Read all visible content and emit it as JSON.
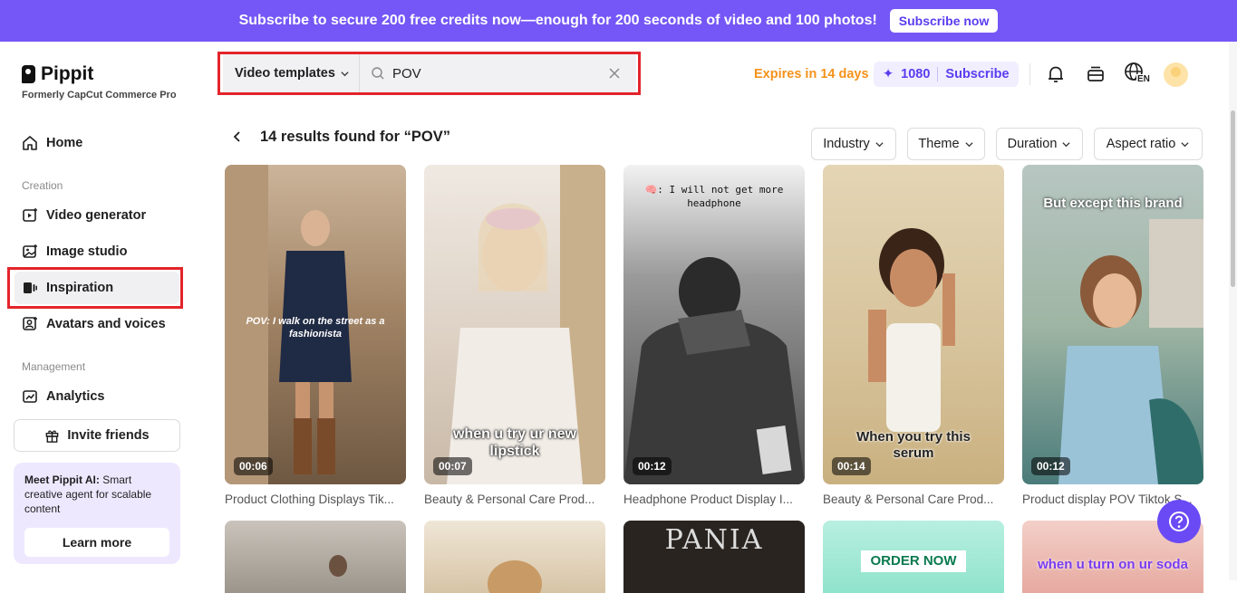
{
  "banner": {
    "text": "Subscribe to secure 200 free credits now—enough for 200 seconds of video and 100 photos!",
    "button": "Subscribe now"
  },
  "brand": {
    "name": "Pippit",
    "subtitle": "Formerly CapCut Commerce Pro"
  },
  "sidebar": {
    "home": "Home",
    "creation_label": "Creation",
    "creation_items": [
      "Video generator",
      "Image studio",
      "Inspiration",
      "Avatars and voices"
    ],
    "management_label": "Management",
    "management_items": [
      "Analytics"
    ],
    "invite": "Invite friends",
    "promo_bold": "Meet Pippit AI:",
    "promo_text": " Smart creative agent for scalable content",
    "learn_more": "Learn more"
  },
  "search": {
    "type": "Video templates",
    "query": "POV"
  },
  "header": {
    "expires": "Expires in 14 days",
    "credits": "1080",
    "subscribe": "Subscribe",
    "lang": "EN"
  },
  "results": {
    "text": "14 results found for “POV”"
  },
  "filters": [
    "Industry",
    "Theme",
    "Duration",
    "Aspect ratio"
  ],
  "templates": [
    {
      "duration": "00:06",
      "title": "Product Clothing Displays Tik...",
      "overlay": "POV: I walk on the street as a fashionista"
    },
    {
      "duration": "00:07",
      "title": "Beauty & Personal Care Prod...",
      "overlay": "when u try ur new lipstick"
    },
    {
      "duration": "00:12",
      "title": "Headphone Product Display I...",
      "overlay": "🧠: I will not get more headphone"
    },
    {
      "duration": "00:14",
      "title": "Beauty & Personal Care Prod...",
      "overlay": "When you try this serum"
    },
    {
      "duration": "00:12",
      "title": "Product display POV Tiktok S...",
      "overlay": "But except this brand"
    }
  ],
  "second_row": [
    {
      "overlay": ""
    },
    {
      "overlay": ""
    },
    {
      "overlay": "PANIA"
    },
    {
      "overlay": "ORDER NOW"
    },
    {
      "overlay": "when u turn on ur soda"
    }
  ]
}
